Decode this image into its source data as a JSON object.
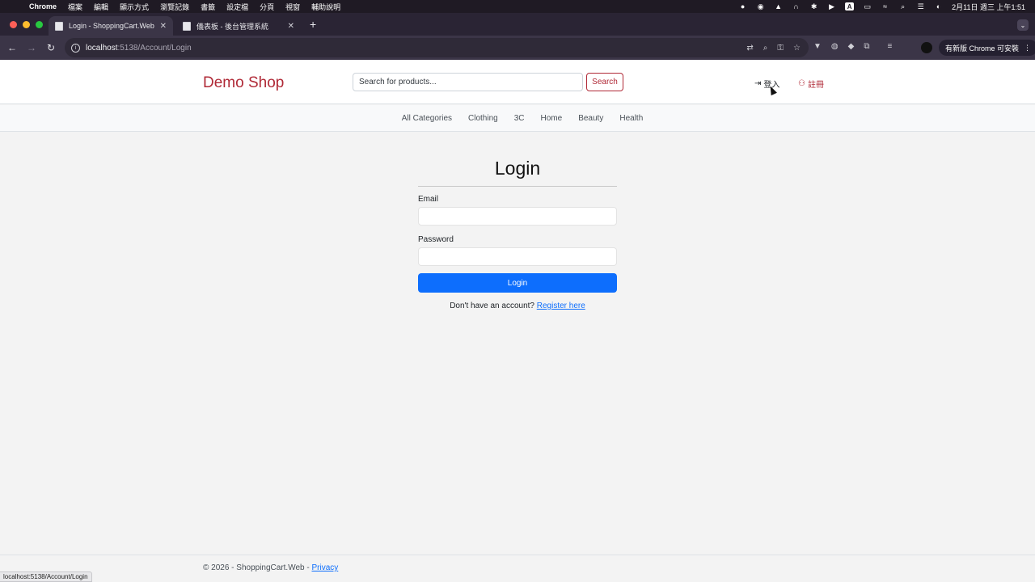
{
  "menubar": {
    "apple_icon": "apple-icon",
    "app_name": "Chrome",
    "items": [
      "檔案",
      "編輯",
      "顯示方式",
      "瀏覽記錄",
      "書籤",
      "設定檔",
      "分頁",
      "視窗",
      "輔助說明"
    ],
    "clock": "2月11日 週三 上午1:51"
  },
  "tabs": [
    {
      "title": "Login - ShoppingCart.Web",
      "active": true
    },
    {
      "title": "儀表板 - 後台管理系統",
      "active": false
    }
  ],
  "toolbar": {
    "url_host": "localhost",
    "url_path": ":5138/Account/Login",
    "update_label": "有新版 Chrome 可安裝"
  },
  "site": {
    "brand": "Demo Shop",
    "search_placeholder": "Search for products...",
    "search_button": "Search",
    "login_link": "登入",
    "register_link": "註冊",
    "accent_color": "#b02a37"
  },
  "categories": [
    "All Categories",
    "Clothing",
    "3C",
    "Home",
    "Beauty",
    "Health"
  ],
  "login_form": {
    "title": "Login",
    "email_label": "Email",
    "email_value": "",
    "password_label": "Password",
    "password_value": "",
    "submit_label": "Login",
    "no_account_text": "Don't have an account?",
    "register_link": "Register here",
    "button_color": "#0d6efd"
  },
  "footer": {
    "copyright": "© 2026 - ShoppingCart.Web -",
    "privacy_link": "Privacy"
  },
  "status_bar": {
    "url": "localhost:5138/Account/Login"
  }
}
